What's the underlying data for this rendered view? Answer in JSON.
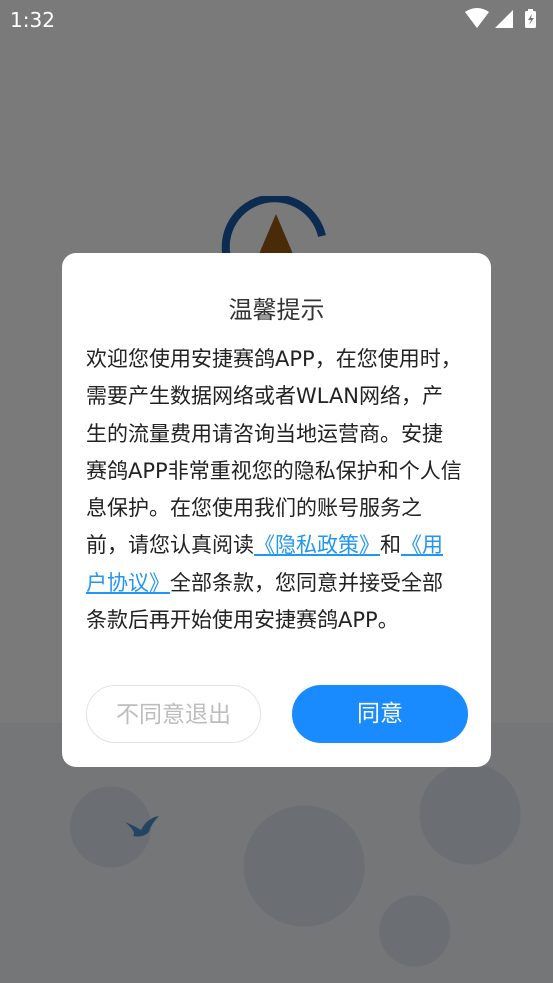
{
  "status_bar": {
    "time": "1:32"
  },
  "dialog": {
    "title": "温馨提示",
    "body": {
      "text_1": "欢迎您使用安捷赛鸽APP，在您使用时，需要产生数据网络或者WLAN网络，产生的流量费用请咨询当地运营商。安捷赛鸽APP非常重视您的隐私保护和个人信息保护。在您使用我们的账号服务之前，请您认真阅读",
      "privacy_link": "《隐私政策》",
      "text_2": "和",
      "terms_link": "《用户协议》",
      "text_3": "全部条款，您同意并接受全部条款后再开始使用安捷赛鸽APP。"
    },
    "decline_button": "不同意退出",
    "agree_button": "同意"
  },
  "colors": {
    "accent": "#1a8bff",
    "link": "#2196f3",
    "overlay": "#000000",
    "logo_blue": "#1a5aa8",
    "logo_brown": "#9a5a12"
  },
  "icons": [
    "wifi-icon",
    "signal-icon",
    "battery-icon",
    "app-logo-icon",
    "pigeon-icon"
  ]
}
